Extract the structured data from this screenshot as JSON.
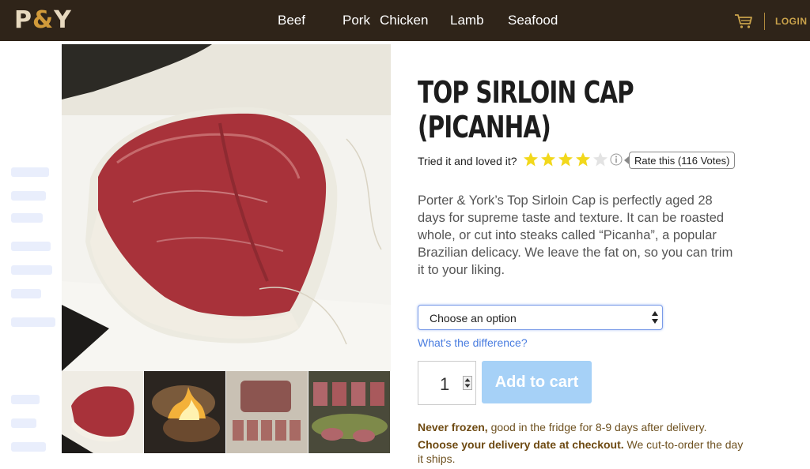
{
  "brand": {
    "logo_left": "P",
    "logo_amp": "&",
    "logo_right": "Y"
  },
  "nav": {
    "items": [
      {
        "label": "Beef"
      },
      {
        "label": "Pork"
      },
      {
        "label": "Chicken"
      },
      {
        "label": "Lamb"
      },
      {
        "label": "Seafood"
      }
    ],
    "login_label": "LOGIN"
  },
  "product": {
    "title": "TOP SIRLOIN CAP (PICANHA)",
    "rating_prompt": "Tried it and loved it?",
    "rating_value": 4,
    "rating_max": 5,
    "rate_button_label": "Rate this (116 Votes)",
    "description": "Porter & York’s Top Sirloin Cap is perfectly aged 28 days for supreme taste and texture.  It can be roasted whole, or cut into steaks called “Picanha”, a popular Brazilian delicacy. We leave the fat on, so you can trim it to your liking.",
    "option_select": {
      "selected": "Choose an option"
    },
    "difference_link": "What's the difference?",
    "quantity": "1",
    "add_to_cart_label": "Add to cart",
    "notes": [
      {
        "bold": "Never frozen,",
        "text": " good in the fridge for 8-9 days after delivery."
      },
      {
        "bold": "Choose your delivery date at checkout.",
        "text": " We cut-to-order the day it ships."
      }
    ]
  },
  "colors": {
    "header_bg": "#2f2419",
    "accent_gold": "#c9a24b",
    "star_yellow": "#f2d81c",
    "button_blue": "#a6d1f7",
    "link_blue": "#4a7de0",
    "note_brown": "#6e5120"
  },
  "icons": {
    "cart": "cart-icon",
    "info": "info-icon",
    "star": "star-icon"
  }
}
